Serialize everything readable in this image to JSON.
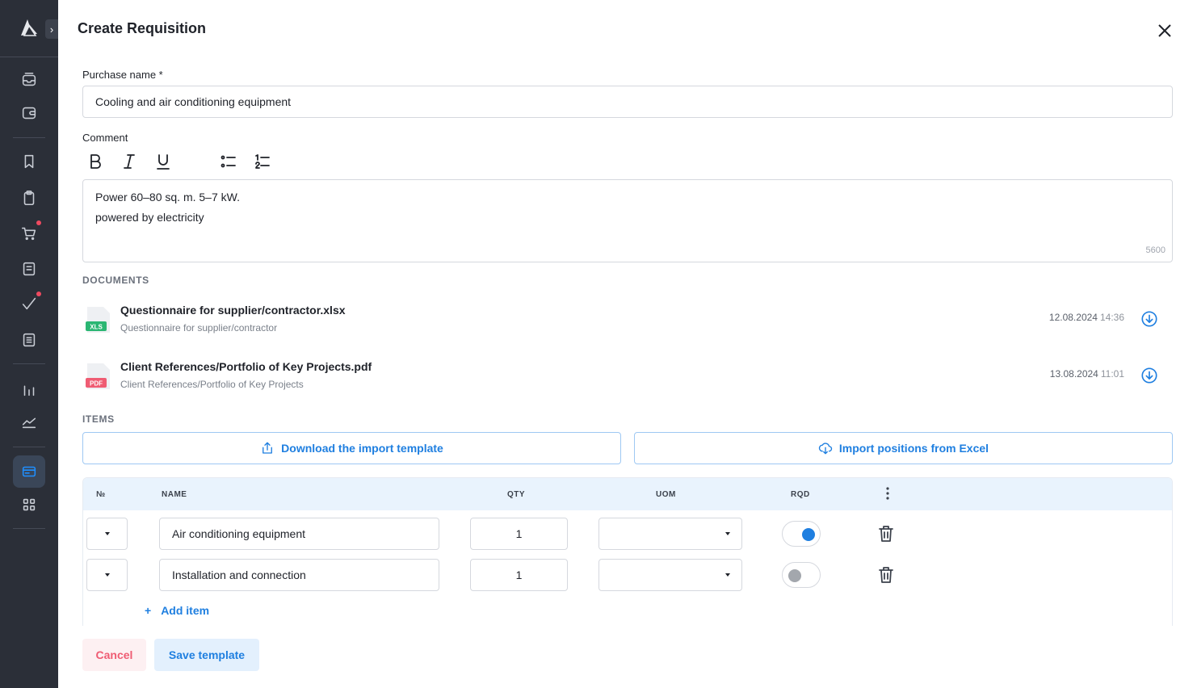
{
  "dialog": {
    "title": "Create Requisition",
    "close_icon": "close-icon"
  },
  "sidebar": {
    "expand_label": "›",
    "items": [
      {
        "name": "inbox-icon",
        "notification": false
      },
      {
        "name": "wallet-icon",
        "notification": false
      },
      {
        "name": "bookmark-icon",
        "notification": false
      },
      {
        "name": "clipboard-icon",
        "notification": false
      },
      {
        "name": "cart-icon",
        "notification": true
      },
      {
        "name": "document-icon",
        "notification": false
      },
      {
        "name": "check-icon",
        "notification": true
      },
      {
        "name": "list-icon",
        "notification": false
      },
      {
        "name": "bar-chart-icon",
        "notification": false
      },
      {
        "name": "line-chart-icon",
        "notification": false
      },
      {
        "name": "card-icon",
        "active": true
      },
      {
        "name": "grid-icon",
        "notification": false
      }
    ]
  },
  "form": {
    "purchase_name_label": "Purchase name *",
    "purchase_name_value": "Cooling and air conditioning equipment",
    "comment_label": "Comment",
    "comment_lines": [
      "Power 60–80 sq. m. 5–7 kW.",
      "powered by electricity"
    ],
    "comment_counter": "5600"
  },
  "documents": {
    "title": "DOCUMENTS",
    "items": [
      {
        "type": "XLS",
        "name": "Questionnaire for supplier/contractor.xlsx",
        "description": "Questionnaire for supplier/contractor",
        "date": "12.08.2024",
        "time": "14:36",
        "color": "#2bb673"
      },
      {
        "type": "PDF",
        "name": "Client References/Portfolio of Key Projects.pdf",
        "description": "Client References/Portfolio of Key Projects",
        "date": "13.08.2024",
        "time": "11:01",
        "color": "#ef5c73"
      }
    ]
  },
  "items": {
    "title": "ITEMS",
    "download_template_label": "Download the import template",
    "import_excel_label": "Import positions from Excel",
    "columns": {
      "no": "№",
      "name": "NAME",
      "qty": "QTY",
      "uom": "UOM",
      "rqd": "RQD"
    },
    "rows": [
      {
        "name": "Air conditioning equipment",
        "qty": "1",
        "uom": "",
        "rqd": true
      },
      {
        "name": "Installation and connection",
        "qty": "1",
        "uom": "",
        "rqd": false
      }
    ],
    "add_item_label": "Add item",
    "add_item_plus": "+"
  },
  "footer": {
    "cancel_label": "Cancel",
    "save_template_label": "Save template"
  },
  "colors": {
    "accent": "#1f7fe0",
    "danger": "#ef5c73",
    "sidebar_bg": "#2b2f38"
  }
}
